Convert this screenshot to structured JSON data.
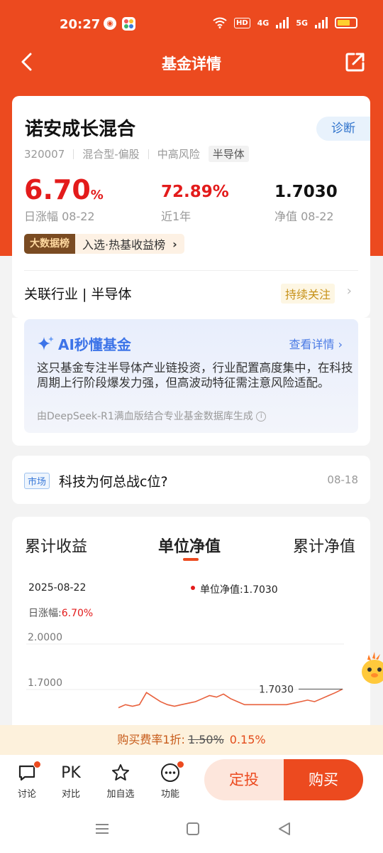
{
  "status": {
    "time": "20:27",
    "hd": "HD",
    "net1": "4G",
    "net2": "5G"
  },
  "nav": {
    "title": "基金详情"
  },
  "fund": {
    "name": "诺安成长混合",
    "diagnose": "诊断",
    "code": "320007",
    "type": "混合型-偏股",
    "risk": "中高风险",
    "sector_tag": "半导体",
    "daily_change": "6.70",
    "daily_change_unit": "%",
    "daily_change_label": "日涨幅 08-22",
    "year_return": "72.89%",
    "year_return_label": "近1年",
    "nav_value": "1.7030",
    "nav_label": "净值 08-22",
    "rank_badge": "大数据榜",
    "rank_text": "入选·热基收益榜",
    "industry_label": "关联行业 | 半导体",
    "follow": "持续关注"
  },
  "ai": {
    "title": "AI秒懂基金",
    "more": "查看详情",
    "body": "这只基金专注半导体产业链投资，行业配置高度集中，在科技周期上行阶段爆发力强，但高波动特征需注意风险适配。",
    "source": "由DeepSeek-R1满血版结合专业基金数据库生成"
  },
  "news": {
    "tag": "市场",
    "title": "科技为何总战c位?",
    "date": "08-18"
  },
  "chart_tabs": [
    "累计收益",
    "单位净值",
    "累计净值"
  ],
  "chart_data": {
    "type": "line",
    "date": "2025-08-22",
    "legend": "单位净值:1.7030",
    "change_label": "日涨幅:",
    "change_value": "6.70%",
    "y_ticks": [
      "2.0000",
      "1.7000"
    ],
    "ylim": [
      1.6,
      2.0
    ],
    "last_value_label": "1.7030",
    "series": [
      {
        "values": [
          1.58,
          1.6,
          1.59,
          1.6,
          1.68,
          1.65,
          1.62,
          1.6,
          1.59,
          1.6,
          1.61,
          1.62,
          1.64,
          1.66,
          1.65,
          1.67,
          1.64,
          1.62,
          1.6,
          1.6,
          1.6,
          1.6,
          1.6,
          1.6,
          1.6,
          1.61,
          1.62,
          1.63,
          1.62,
          1.64,
          1.66,
          1.68,
          1.703
        ]
      }
    ],
    "color": "#e8603c"
  },
  "fee": {
    "prefix": "购买费率1折:",
    "original": "1.50%",
    "current": "0.15%"
  },
  "bottom": {
    "discuss": "讨论",
    "pk_icon": "PK",
    "pk": "对比",
    "watch": "加自选",
    "func": "功能",
    "sip": "定投",
    "buy": "购买"
  }
}
